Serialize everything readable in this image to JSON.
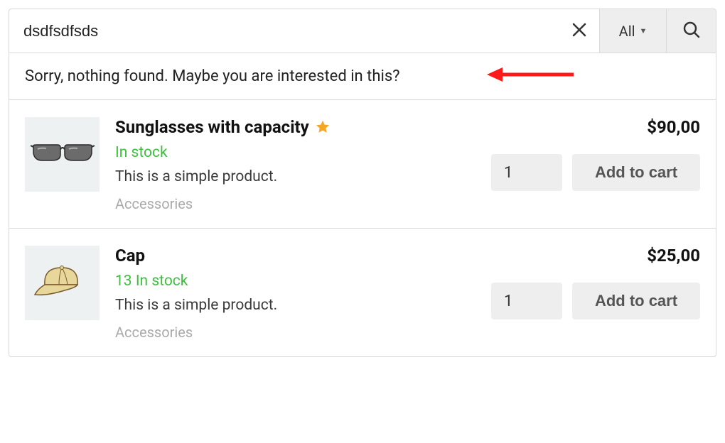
{
  "search": {
    "value": "dsdfsdfsds",
    "filter_label": "All"
  },
  "message": "Sorry, nothing found. Maybe you are interested in this?",
  "products": [
    {
      "title": "Sunglasses with capacity",
      "featured": true,
      "stock": "In stock",
      "desc": "This is a simple product.",
      "category": "Accessories",
      "price": "$90,00",
      "qty": "1",
      "add_label": "Add to cart"
    },
    {
      "title": "Cap",
      "featured": false,
      "stock": "13 In stock",
      "desc": "This is a simple product.",
      "category": "Accessories",
      "price": "$25,00",
      "qty": "1",
      "add_label": "Add to cart"
    }
  ]
}
